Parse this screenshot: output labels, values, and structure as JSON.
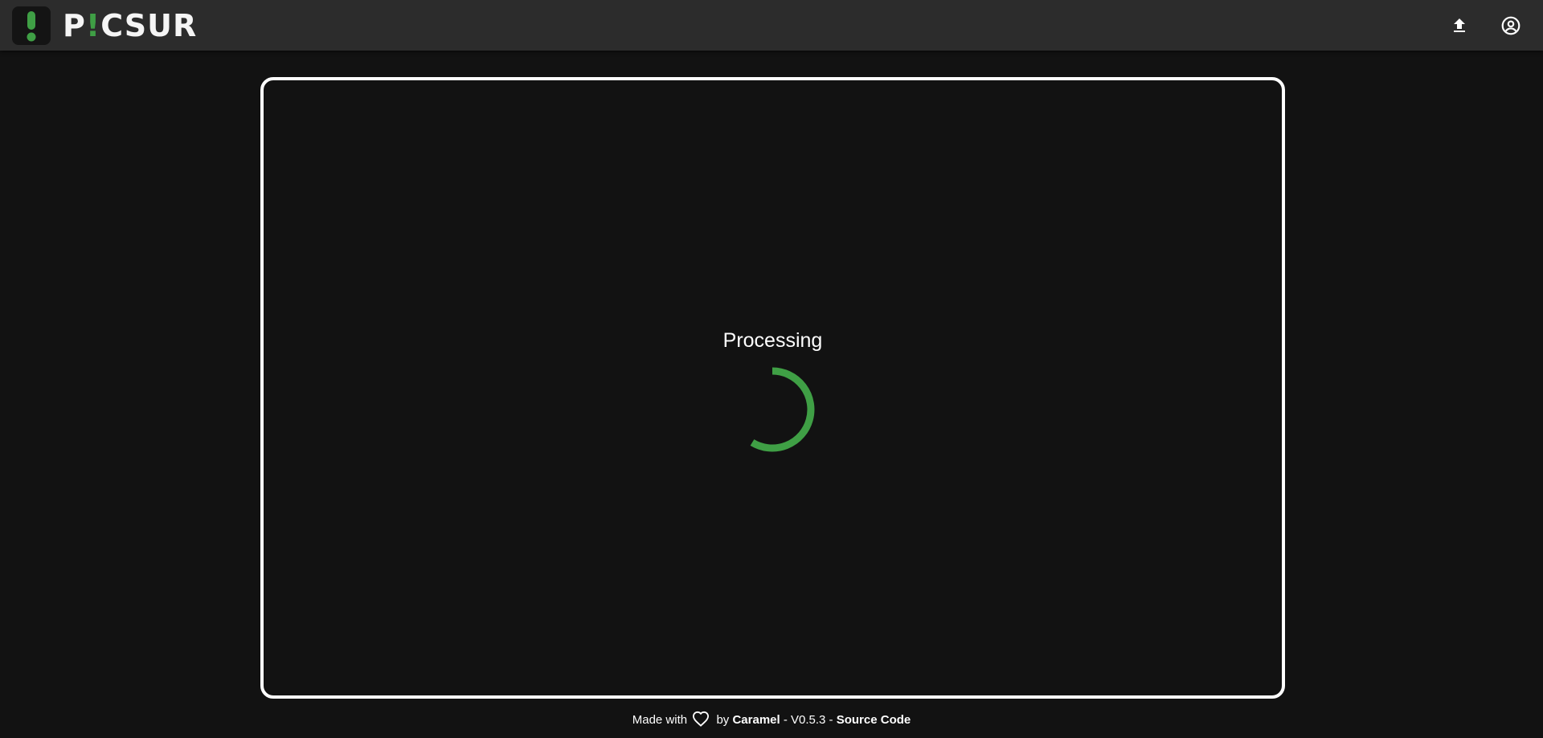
{
  "header": {
    "brand": {
      "prefix": "P",
      "bang": "!",
      "suffix": "CSUR"
    },
    "actions": [
      {
        "icon": "upload-icon"
      },
      {
        "icon": "account-circle-icon"
      }
    ]
  },
  "main": {
    "status_text": "Processing",
    "spinner_color": "#3f9f45"
  },
  "footer": {
    "made_with": "Made with",
    "by": "by",
    "author": "Caramel",
    "version_text": "- V0.5.3 -",
    "source_link": "Source Code"
  },
  "colors": {
    "background": "#121212",
    "topbar": "#2c2c2c",
    "accent": "#3f9f45"
  }
}
